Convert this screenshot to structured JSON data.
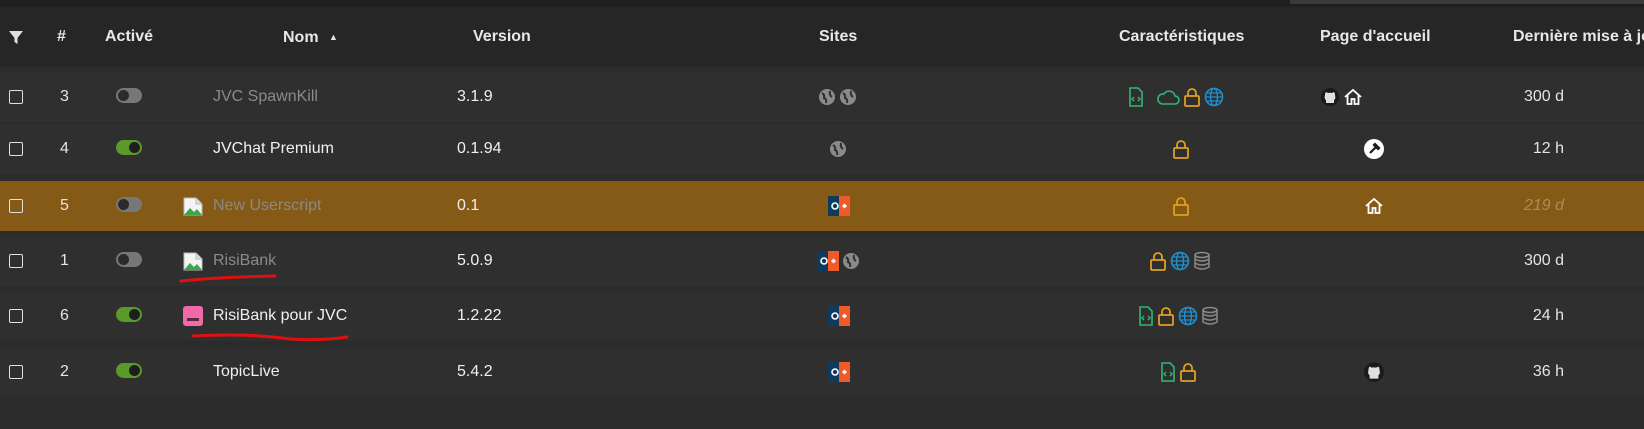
{
  "header": {
    "filter_icon": "filter-icon",
    "num": "#",
    "enabled": "Activé",
    "name": "Nom",
    "sort_icon": "sort-asc-icon",
    "version": "Version",
    "sites": "Sites",
    "features": "Caractéristiques",
    "homepage": "Page d'accueil",
    "updated": "Dernière mise à jo"
  },
  "rows": [
    {
      "num": "3",
      "enabled": false,
      "name": "JVC SpawnKill",
      "version": "3.1.9",
      "sites": [
        "globe",
        "globe"
      ],
      "features": [
        "file-code",
        "cloud",
        "lock",
        "web"
      ],
      "homepage": [
        "github",
        "home"
      ],
      "updated": "300 d"
    },
    {
      "num": "4",
      "enabled": true,
      "name": "JVChat Premium",
      "version": "0.1.94",
      "sites": [
        "globe"
      ],
      "features": [
        "lock"
      ],
      "homepage": [
        "tool"
      ],
      "updated": "12 h"
    },
    {
      "num": "5",
      "enabled": false,
      "name": "New Userscript",
      "version": "0.1",
      "sites": [
        "jvc"
      ],
      "features": [
        "lock"
      ],
      "homepage": [
        "home"
      ],
      "updated": "219 d",
      "highlighted": true
    },
    {
      "num": "1",
      "enabled": false,
      "name": "RisiBank",
      "version": "5.0.9",
      "sites": [
        "jvc",
        "globe"
      ],
      "features": [
        "lock",
        "web",
        "database"
      ],
      "homepage": [],
      "updated": "300 d"
    },
    {
      "num": "6",
      "enabled": true,
      "name": "RisiBank pour JVC",
      "version": "1.2.22",
      "sites": [
        "jvc"
      ],
      "features": [
        "file-code",
        "lock",
        "web",
        "database"
      ],
      "homepage": [],
      "updated": "24 h"
    },
    {
      "num": "2",
      "enabled": true,
      "name": "TopicLive",
      "version": "5.4.2",
      "sites": [
        "jvc"
      ],
      "features": [
        "file-code",
        "lock"
      ],
      "homepage": [
        "github"
      ],
      "updated": "36 h"
    }
  ],
  "colors": {
    "background": "#2b2b2b",
    "row": "#2f2f2f",
    "highlight_row": "#845a16",
    "toggle_on": "#5a9a2a",
    "lock": "#e0a020",
    "web": "#1e90d0",
    "file_code": "#2eb872",
    "annotation": "#e01010"
  }
}
